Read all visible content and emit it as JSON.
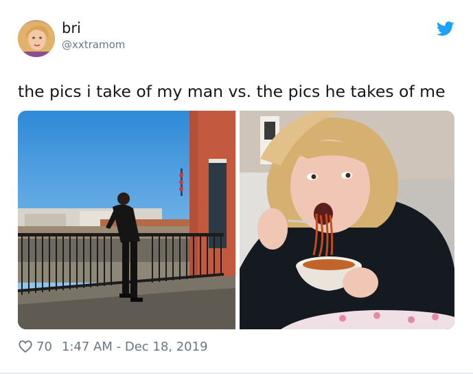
{
  "author": {
    "display_name": "bri",
    "handle": "@xxtramom"
  },
  "tweet": {
    "text": "the pics i take of my man vs. the pics he takes of me"
  },
  "stats": {
    "likes": "70",
    "timestamp": "1:47 AM - Dec 18, 2019"
  },
  "icons": {
    "brand": "twitter-bird-icon",
    "like": "heart-outline-icon"
  },
  "colors": {
    "brand": "#1da1f2",
    "text": "#14171a",
    "muted": "#657786"
  }
}
